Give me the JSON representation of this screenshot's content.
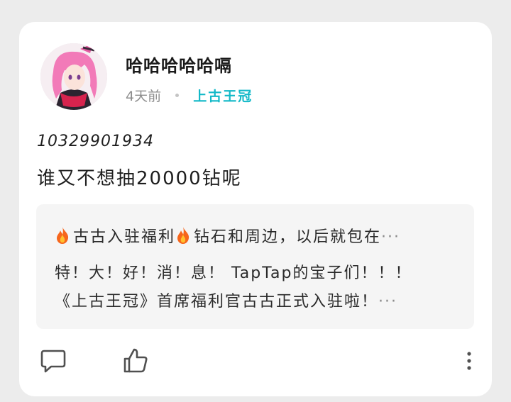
{
  "post": {
    "author": {
      "name": "哈哈哈哈哈嗝",
      "avatar_icon": "anime-avatar"
    },
    "time": "4天前",
    "tag": "上古王冠",
    "id_text": "10329901934",
    "text": "谁又不想抽20000钻呢"
  },
  "quote": {
    "line1_a": "古古入驻福利",
    "line1_b": "钻石和周边，以后就包在",
    "line2": "特！大！好！消！息！ TapTap的宝子们！！！",
    "line3": "《上古王冠》首席福利官古古正式入驻啦！",
    "ellipsis": "···"
  },
  "actions": {
    "comment_icon": "comment-icon",
    "like_icon": "thumbs-up-icon",
    "more_icon": "more-vertical-icon"
  },
  "colors": {
    "accent": "#14b9c8",
    "fire": "#f6661c"
  }
}
